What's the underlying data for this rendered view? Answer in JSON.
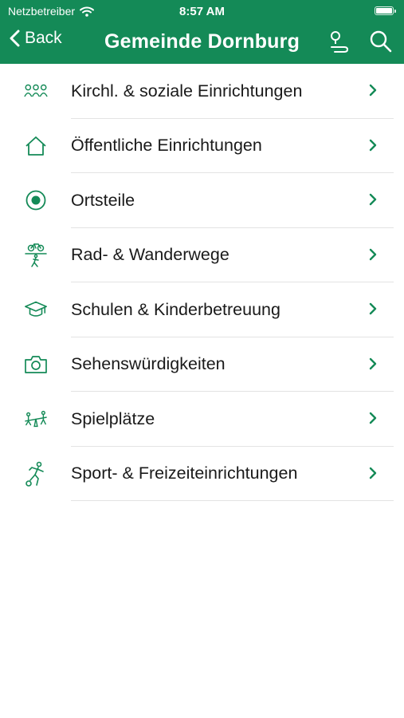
{
  "status_bar": {
    "carrier": "Netzbetreiber",
    "time": "8:57 AM"
  },
  "nav": {
    "back_label": "Back",
    "title": "Gemeinde Dornburg"
  },
  "colors": {
    "accent": "#148a57",
    "separator": "#e3e3e3"
  },
  "list": {
    "items": [
      {
        "label": "Kirchl. & soziale Einrichtungen",
        "icon": "people-group-icon"
      },
      {
        "label": "Öffentliche Einrichtungen",
        "icon": "house-icon"
      },
      {
        "label": "Ortsteile",
        "icon": "location-target-icon"
      },
      {
        "label": "Rad- & Wanderwege",
        "icon": "bike-hike-icon"
      },
      {
        "label": "Schulen & Kinderbetreuung",
        "icon": "graduation-cap-icon"
      },
      {
        "label": "Sehenswürdigkeiten",
        "icon": "camera-icon"
      },
      {
        "label": "Spielplätze",
        "icon": "playground-icon"
      },
      {
        "label": "Sport- & Freizeiteinrichtungen",
        "icon": "sport-icon"
      }
    ]
  }
}
